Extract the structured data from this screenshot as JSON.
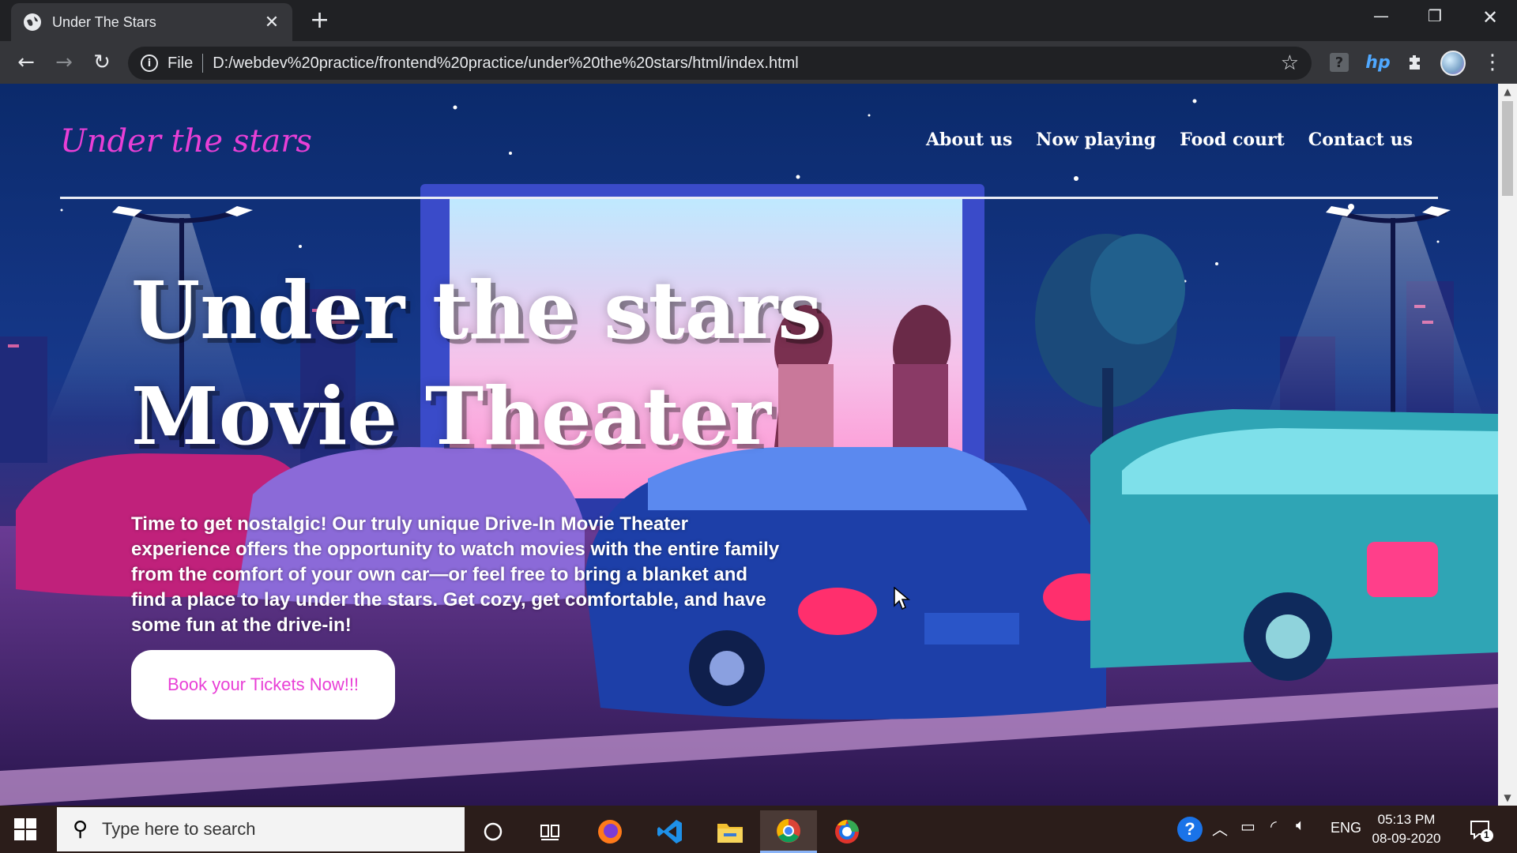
{
  "browser": {
    "tab_title": "Under The Stars",
    "url_scheme": "File",
    "url": "D:/webdev%20practice/frontend%20practice/under%20the%20stars/html/index.html"
  },
  "site": {
    "logo": "Under the stars",
    "nav": [
      "About us",
      "Now playing",
      "Food court",
      "Contact us"
    ],
    "hero_title_line1": "Under the stars",
    "hero_title_line2": "Movie Theater",
    "hero_text": "Time to get nostalgic! Our truly unique Drive-In Movie Theater experience offers the opportunity to watch movies with the entire family from the comfort of your own car—or feel free to bring a blanket and find a place to lay under the stars. Get cozy, get comfortable, and have some fun at the drive-in!",
    "cta_label": "Book your Tickets Now!!!",
    "accent_color": "#e83fd6"
  },
  "taskbar": {
    "search_placeholder": "Type here to search",
    "language": "ENG",
    "time": "05:13 PM",
    "date": "08-09-2020",
    "notification_count": "1"
  }
}
